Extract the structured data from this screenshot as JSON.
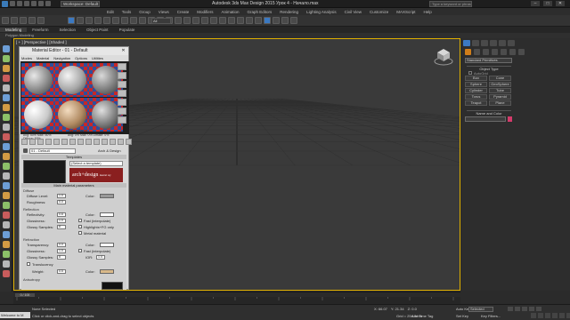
{
  "titlebar": {
    "workspace": "Workspace: Default",
    "title": "Autodesk 3ds Max Design 2015   Урок 4 - Начало.max",
    "search_placeholder": "Type a keyword or phrase"
  },
  "menubar": [
    "Edit",
    "Tools",
    "Group",
    "Views",
    "Create",
    "Modifiers",
    "Animation",
    "Graph Editors",
    "Rendering",
    "Lighting Analysis",
    "Civil View",
    "Customize",
    "MAXScript",
    "Help"
  ],
  "toolbar": {
    "selection_filter": "All"
  },
  "ribbon": {
    "tabs": [
      "Modeling",
      "Freeform",
      "Selection",
      "Object Paint",
      "Populate"
    ],
    "active": "Modeling",
    "sub": "Polygon Modeling"
  },
  "viewport": {
    "label": "[ + ] [Perspective ] [Shaded ]"
  },
  "material_editor": {
    "title": "Material Editor - 01 - Default",
    "menu": [
      "Modes",
      "Material",
      "Navigation",
      "Options",
      "Utilities"
    ],
    "reflectance": "Reflectance\nAvg: 50% Max: 50%\nDiffuse: 50%",
    "transmittance": "Transmittance\nAvg: 0% Max: 0% Diffuse: 0%",
    "material_name": "01 - Default",
    "material_type": "Arch & Design",
    "templates_header": "Templates",
    "template_select": "(Select a template)",
    "logo": "arch+design",
    "logo_sub": "mental ray",
    "main_params_header": "Main material parameters",
    "diffuse": {
      "group": "Diffuse",
      "level_label": "Diffuse Level:",
      "level": "1.0",
      "roughness_label": "Roughness:",
      "roughness": "0.0",
      "color_label": "Color:"
    },
    "reflection": {
      "group": "Reflection",
      "reflectivity_label": "Reflectivity:",
      "reflectivity": "0.6",
      "glossiness_label": "Glossiness:",
      "glossiness": "1.0",
      "samples_label": "Glossy Samples:",
      "samples": "8",
      "color_label": "Color:",
      "fast_interp": "Fast (interpolate)",
      "highlights": "Highlights+FG only",
      "metal": "Metal material"
    },
    "refraction": {
      "group": "Refraction",
      "transparency_label": "Transparency:",
      "transparency": "0.0",
      "glossiness_label": "Glossiness:",
      "glossiness": "1.0",
      "samples_label": "Glossy Samples:",
      "samples": "8",
      "color_label": "Color:",
      "fast_interp": "Fast (interpolate)",
      "ior_label": "IOR:",
      "ior": "1.4",
      "translucency": "Translucency",
      "weight_label": "Weight:",
      "weight": "0.5",
      "color2_label": "Color:"
    },
    "anisotropy": "Anisotropy"
  },
  "command_panel": {
    "dropdown": "Standard Primitives",
    "object_type_header": "Object Type",
    "autogrid": "AutoGrid",
    "buttons": [
      "Box",
      "Cone",
      "Sphere",
      "GeoSphere",
      "Cylinder",
      "Tube",
      "Torus",
      "Pyramid",
      "Teapot",
      "Plane"
    ],
    "name_color_header": "Name and Color",
    "color": "#d43b6b"
  },
  "timeslider": {
    "label": "0 / 100"
  },
  "statusbar": {
    "welcome": "Welcome to M",
    "selection": "None Selected",
    "prompt": "Click or click-and-drag to select objects",
    "x": "X: 66.07",
    "y": "Y: 21.34",
    "z": "Z: 0.0",
    "grid": "Grid = 254.0mm",
    "add_time_tag": "Add Time Tag",
    "auto_key": "Auto Key",
    "selected": "Selected",
    "set_key": "Set Key",
    "key_filters": "Key Filters..."
  }
}
